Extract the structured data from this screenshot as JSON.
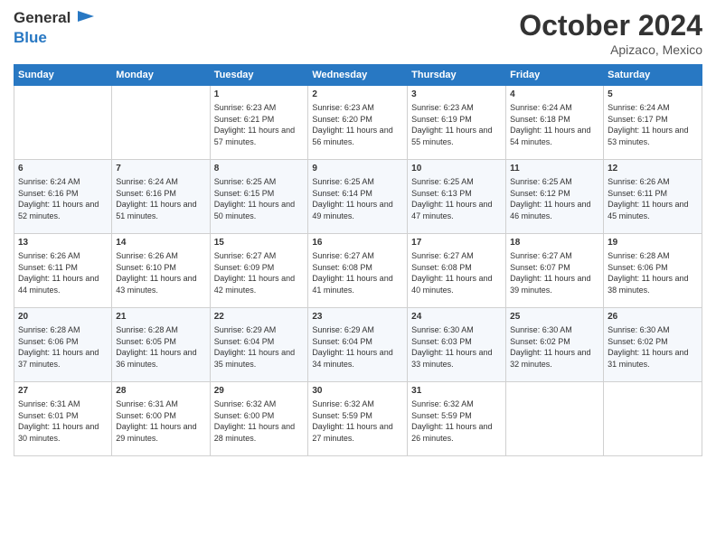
{
  "header": {
    "logo_general": "General",
    "logo_blue": "Blue",
    "month_title": "October 2024",
    "location": "Apizaco, Mexico"
  },
  "days_of_week": [
    "Sunday",
    "Monday",
    "Tuesday",
    "Wednesday",
    "Thursday",
    "Friday",
    "Saturday"
  ],
  "weeks": [
    [
      {
        "day": "",
        "sunrise": "",
        "sunset": "",
        "daylight": ""
      },
      {
        "day": "",
        "sunrise": "",
        "sunset": "",
        "daylight": ""
      },
      {
        "day": "1",
        "sunrise": "Sunrise: 6:23 AM",
        "sunset": "Sunset: 6:21 PM",
        "daylight": "Daylight: 11 hours and 57 minutes."
      },
      {
        "day": "2",
        "sunrise": "Sunrise: 6:23 AM",
        "sunset": "Sunset: 6:20 PM",
        "daylight": "Daylight: 11 hours and 56 minutes."
      },
      {
        "day": "3",
        "sunrise": "Sunrise: 6:23 AM",
        "sunset": "Sunset: 6:19 PM",
        "daylight": "Daylight: 11 hours and 55 minutes."
      },
      {
        "day": "4",
        "sunrise": "Sunrise: 6:24 AM",
        "sunset": "Sunset: 6:18 PM",
        "daylight": "Daylight: 11 hours and 54 minutes."
      },
      {
        "day": "5",
        "sunrise": "Sunrise: 6:24 AM",
        "sunset": "Sunset: 6:17 PM",
        "daylight": "Daylight: 11 hours and 53 minutes."
      }
    ],
    [
      {
        "day": "6",
        "sunrise": "Sunrise: 6:24 AM",
        "sunset": "Sunset: 6:16 PM",
        "daylight": "Daylight: 11 hours and 52 minutes."
      },
      {
        "day": "7",
        "sunrise": "Sunrise: 6:24 AM",
        "sunset": "Sunset: 6:16 PM",
        "daylight": "Daylight: 11 hours and 51 minutes."
      },
      {
        "day": "8",
        "sunrise": "Sunrise: 6:25 AM",
        "sunset": "Sunset: 6:15 PM",
        "daylight": "Daylight: 11 hours and 50 minutes."
      },
      {
        "day": "9",
        "sunrise": "Sunrise: 6:25 AM",
        "sunset": "Sunset: 6:14 PM",
        "daylight": "Daylight: 11 hours and 49 minutes."
      },
      {
        "day": "10",
        "sunrise": "Sunrise: 6:25 AM",
        "sunset": "Sunset: 6:13 PM",
        "daylight": "Daylight: 11 hours and 47 minutes."
      },
      {
        "day": "11",
        "sunrise": "Sunrise: 6:25 AM",
        "sunset": "Sunset: 6:12 PM",
        "daylight": "Daylight: 11 hours and 46 minutes."
      },
      {
        "day": "12",
        "sunrise": "Sunrise: 6:26 AM",
        "sunset": "Sunset: 6:11 PM",
        "daylight": "Daylight: 11 hours and 45 minutes."
      }
    ],
    [
      {
        "day": "13",
        "sunrise": "Sunrise: 6:26 AM",
        "sunset": "Sunset: 6:11 PM",
        "daylight": "Daylight: 11 hours and 44 minutes."
      },
      {
        "day": "14",
        "sunrise": "Sunrise: 6:26 AM",
        "sunset": "Sunset: 6:10 PM",
        "daylight": "Daylight: 11 hours and 43 minutes."
      },
      {
        "day": "15",
        "sunrise": "Sunrise: 6:27 AM",
        "sunset": "Sunset: 6:09 PM",
        "daylight": "Daylight: 11 hours and 42 minutes."
      },
      {
        "day": "16",
        "sunrise": "Sunrise: 6:27 AM",
        "sunset": "Sunset: 6:08 PM",
        "daylight": "Daylight: 11 hours and 41 minutes."
      },
      {
        "day": "17",
        "sunrise": "Sunrise: 6:27 AM",
        "sunset": "Sunset: 6:08 PM",
        "daylight": "Daylight: 11 hours and 40 minutes."
      },
      {
        "day": "18",
        "sunrise": "Sunrise: 6:27 AM",
        "sunset": "Sunset: 6:07 PM",
        "daylight": "Daylight: 11 hours and 39 minutes."
      },
      {
        "day": "19",
        "sunrise": "Sunrise: 6:28 AM",
        "sunset": "Sunset: 6:06 PM",
        "daylight": "Daylight: 11 hours and 38 minutes."
      }
    ],
    [
      {
        "day": "20",
        "sunrise": "Sunrise: 6:28 AM",
        "sunset": "Sunset: 6:06 PM",
        "daylight": "Daylight: 11 hours and 37 minutes."
      },
      {
        "day": "21",
        "sunrise": "Sunrise: 6:28 AM",
        "sunset": "Sunset: 6:05 PM",
        "daylight": "Daylight: 11 hours and 36 minutes."
      },
      {
        "day": "22",
        "sunrise": "Sunrise: 6:29 AM",
        "sunset": "Sunset: 6:04 PM",
        "daylight": "Daylight: 11 hours and 35 minutes."
      },
      {
        "day": "23",
        "sunrise": "Sunrise: 6:29 AM",
        "sunset": "Sunset: 6:04 PM",
        "daylight": "Daylight: 11 hours and 34 minutes."
      },
      {
        "day": "24",
        "sunrise": "Sunrise: 6:30 AM",
        "sunset": "Sunset: 6:03 PM",
        "daylight": "Daylight: 11 hours and 33 minutes."
      },
      {
        "day": "25",
        "sunrise": "Sunrise: 6:30 AM",
        "sunset": "Sunset: 6:02 PM",
        "daylight": "Daylight: 11 hours and 32 minutes."
      },
      {
        "day": "26",
        "sunrise": "Sunrise: 6:30 AM",
        "sunset": "Sunset: 6:02 PM",
        "daylight": "Daylight: 11 hours and 31 minutes."
      }
    ],
    [
      {
        "day": "27",
        "sunrise": "Sunrise: 6:31 AM",
        "sunset": "Sunset: 6:01 PM",
        "daylight": "Daylight: 11 hours and 30 minutes."
      },
      {
        "day": "28",
        "sunrise": "Sunrise: 6:31 AM",
        "sunset": "Sunset: 6:00 PM",
        "daylight": "Daylight: 11 hours and 29 minutes."
      },
      {
        "day": "29",
        "sunrise": "Sunrise: 6:32 AM",
        "sunset": "Sunset: 6:00 PM",
        "daylight": "Daylight: 11 hours and 28 minutes."
      },
      {
        "day": "30",
        "sunrise": "Sunrise: 6:32 AM",
        "sunset": "Sunset: 5:59 PM",
        "daylight": "Daylight: 11 hours and 27 minutes."
      },
      {
        "day": "31",
        "sunrise": "Sunrise: 6:32 AM",
        "sunset": "Sunset: 5:59 PM",
        "daylight": "Daylight: 11 hours and 26 minutes."
      },
      {
        "day": "",
        "sunrise": "",
        "sunset": "",
        "daylight": ""
      },
      {
        "day": "",
        "sunrise": "",
        "sunset": "",
        "daylight": ""
      }
    ]
  ]
}
